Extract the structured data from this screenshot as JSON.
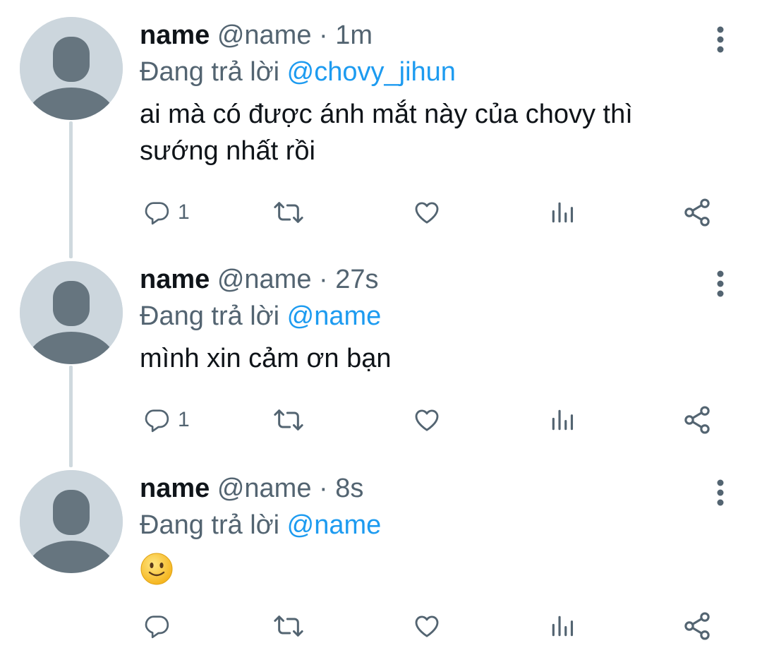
{
  "tweets": [
    {
      "display_name": "name",
      "handle": "@name",
      "separator": "·",
      "time": "1m",
      "reply_prefix": "Đang trả lời",
      "reply_to": "@chovy_jihun",
      "text": "ai mà có được ánh mắt này của chovy thì sướng nhất rồi",
      "reply_count": "1",
      "avatar_icon": "default-avatar-icon"
    },
    {
      "display_name": "name",
      "handle": "@name",
      "separator": "·",
      "time": "27s",
      "reply_prefix": "Đang trả lời",
      "reply_to": "@name",
      "text": "mình xin cảm ơn bạn",
      "reply_count": "1",
      "avatar_icon": "default-avatar-icon"
    },
    {
      "display_name": "name",
      "handle": "@name",
      "separator": "·",
      "time": "8s",
      "reply_prefix": "Đang trả lời",
      "reply_to": "@name",
      "text_emoji": "slightly-smiling-face",
      "reply_count": "",
      "avatar_icon": "default-avatar-icon"
    }
  ],
  "actions": [
    "reply-icon",
    "retweet-icon",
    "like-icon",
    "views-icon",
    "share-icon"
  ],
  "colors": {
    "accent": "#1d9bf0",
    "secondary_text": "#536471",
    "primary_text": "#0f1419",
    "avatar_bg": "#ccd6dd",
    "avatar_figure": "#66757f",
    "thread_line": "#cfd9de"
  }
}
